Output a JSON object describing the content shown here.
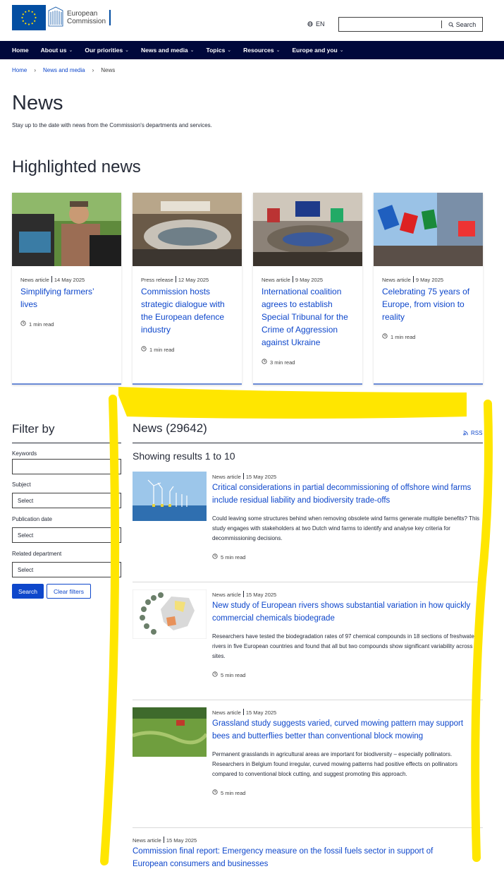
{
  "header": {
    "logo_line1": "European",
    "logo_line2": "Commission",
    "language": "EN",
    "search_placeholder": "",
    "search_label": "Search"
  },
  "nav": {
    "items": [
      {
        "label": "Home",
        "has_menu": false
      },
      {
        "label": "About us",
        "has_menu": true
      },
      {
        "label": "Our priorities",
        "has_menu": true
      },
      {
        "label": "News and media",
        "has_menu": true
      },
      {
        "label": "Topics",
        "has_menu": true
      },
      {
        "label": "Resources",
        "has_menu": true
      },
      {
        "label": "Europe and you",
        "has_menu": true
      }
    ]
  },
  "breadcrumb": {
    "items": [
      "Home",
      "News and media",
      "News"
    ]
  },
  "page": {
    "title": "News",
    "intro": "Stay up to the date with news from the Commission's departments and services."
  },
  "highlighted": {
    "title": "Highlighted news",
    "cards": [
      {
        "type": "News article",
        "date": "14 May 2025",
        "title": "Simplifying farmers’ lives",
        "read": "1 min read"
      },
      {
        "type": "Press release",
        "date": "12 May 2025",
        "title": "Commission hosts strategic dialogue with the European defence industry",
        "read": "1 min read"
      },
      {
        "type": "News article",
        "date": "9 May 2025",
        "title": "International coalition agrees to establish Special Tribunal for the Crime of Aggression against Ukraine",
        "read": "3 min read"
      },
      {
        "type": "News article",
        "date": "9 May 2025",
        "title": "Celebrating 75 years of Europe, from vision to reality",
        "read": "1 min read"
      }
    ]
  },
  "filter": {
    "title": "Filter by",
    "keywords_label": "Keywords",
    "keywords_value": "",
    "subject_label": "Subject",
    "subject_value": "Select",
    "pubdate_label": "Publication date",
    "pubdate_value": "Select",
    "dept_label": "Related department",
    "dept_value": "Select",
    "search_button": "Search",
    "clear_button": "Clear filters"
  },
  "news": {
    "heading": "News (29642)",
    "rss": "RSS",
    "results": "Showing results 1 to 10",
    "items": [
      {
        "type": "News article",
        "date": "15 May 2025",
        "title": "Critical considerations in partial decommissioning of offshore wind farms include residual liability and biodiversity trade-offs",
        "desc": "Could leaving some structures behind when removing obsolete wind farms generate multiple benefits? This study engages with stakeholders at two Dutch wind farms to identify and analyse key criteria for decommissioning decisions.",
        "read": "5 min read"
      },
      {
        "type": "News article",
        "date": "15 May 2025",
        "title": "New study of European rivers shows substantial variation in how quickly commercial chemicals biodegrade",
        "desc": "Researchers have tested the biodegradation rates of 97 chemical compounds in 18 sections of freshwater rivers in five European countries and found that all but two compounds show significant variability across sites.",
        "read": "5 min read"
      },
      {
        "type": "News article",
        "date": "15 May 2025",
        "title": "Grassland study suggests varied, curved mowing pattern may support bees and butterflies better than conventional block mowing",
        "desc": "Permanent grasslands in agricultural areas are important for biodiversity – especially pollinators. Researchers in Belgium found irregular, curved mowing patterns had positive effects on pollinators compared to conventional block cutting, and suggest promoting this approach.",
        "read": "5 min read"
      },
      {
        "type": "News article",
        "date": "15 May 2025",
        "title": "Commission final report: Emergency measure on the fossil fuels sector in support of European consumers and businesses"
      }
    ]
  },
  "colors": {
    "nav_bg": "#00083b",
    "link": "#0e47cb",
    "highlight_marker": "#ffe600"
  }
}
